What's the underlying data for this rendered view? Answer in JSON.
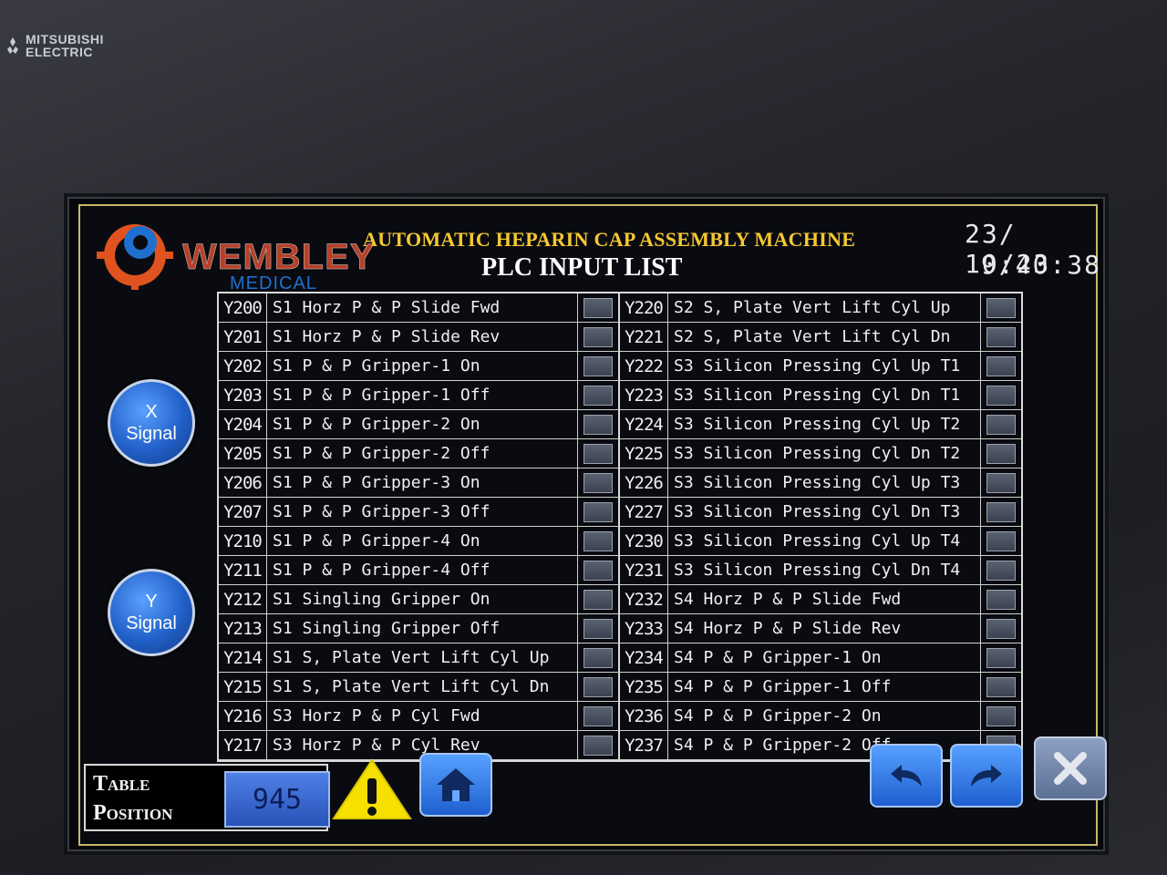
{
  "bezel": {
    "brand_line1": "MITSUBISHI",
    "brand_line2": "ELECTRIC"
  },
  "header": {
    "company": "WEMBLEY",
    "company_sub": "MEDICAL",
    "machine_title": "AUTOMATIC HEPARIN CAP ASSEMBLY MACHINE",
    "screen_title": "PLC INPUT LIST",
    "date": "23/ 10/23",
    "time": "9:40:38"
  },
  "side_buttons": {
    "x_signal": {
      "line1": "X",
      "line2": "Signal"
    },
    "y_signal": {
      "line1": "Y",
      "line2": "Signal"
    }
  },
  "left_rows": [
    {
      "addr": "Y200",
      "desc": "S1 Horz P & P Slide Fwd"
    },
    {
      "addr": "Y201",
      "desc": "S1 Horz P & P Slide Rev"
    },
    {
      "addr": "Y202",
      "desc": "S1 P & P Gripper-1 On"
    },
    {
      "addr": "Y203",
      "desc": "S1 P & P Gripper-1 Off"
    },
    {
      "addr": "Y204",
      "desc": "S1 P & P Gripper-2 On"
    },
    {
      "addr": "Y205",
      "desc": "S1 P & P Gripper-2 Off"
    },
    {
      "addr": "Y206",
      "desc": "S1 P & P Gripper-3 On"
    },
    {
      "addr": "Y207",
      "desc": "S1 P & P Gripper-3 Off"
    },
    {
      "addr": "Y210",
      "desc": "S1 P & P Gripper-4 On"
    },
    {
      "addr": "Y211",
      "desc": "S1 P & P Gripper-4 Off"
    },
    {
      "addr": "Y212",
      "desc": "S1 Singling Gripper On"
    },
    {
      "addr": "Y213",
      "desc": "S1 Singling Gripper Off"
    },
    {
      "addr": "Y214",
      "desc": "S1 S, Plate Vert Lift Cyl Up"
    },
    {
      "addr": "Y215",
      "desc": "S1 S, Plate Vert Lift Cyl Dn"
    },
    {
      "addr": "Y216",
      "desc": "S3 Horz P & P Cyl Fwd"
    },
    {
      "addr": "Y217",
      "desc": "S3 Horz P & P Cyl Rev"
    }
  ],
  "right_rows": [
    {
      "addr": "Y220",
      "desc": "S2 S, Plate Vert Lift Cyl Up"
    },
    {
      "addr": "Y221",
      "desc": "S2 S, Plate Vert Lift Cyl Dn"
    },
    {
      "addr": "Y222",
      "desc": "S3 Silicon Pressing Cyl Up T1"
    },
    {
      "addr": "Y223",
      "desc": "S3 Silicon Pressing Cyl Dn T1"
    },
    {
      "addr": "Y224",
      "desc": "S3 Silicon Pressing Cyl Up T2"
    },
    {
      "addr": "Y225",
      "desc": "S3 Silicon Pressing Cyl Dn T2"
    },
    {
      "addr": "Y226",
      "desc": "S3 Silicon Pressing Cyl Up T3"
    },
    {
      "addr": "Y227",
      "desc": "S3 Silicon Pressing Cyl Dn T3"
    },
    {
      "addr": "Y230",
      "desc": "S3 Silicon Pressing Cyl Up T4"
    },
    {
      "addr": "Y231",
      "desc": "S3 Silicon Pressing Cyl Dn T4"
    },
    {
      "addr": "Y232",
      "desc": "S4 Horz P & P Slide Fwd"
    },
    {
      "addr": "Y233",
      "desc": "S4 Horz P & P Slide Rev"
    },
    {
      "addr": "Y234",
      "desc": "S4 P & P Gripper-1 On"
    },
    {
      "addr": "Y235",
      "desc": "S4 P & P Gripper-1 Off"
    },
    {
      "addr": "Y236",
      "desc": "S4 P & P Gripper-2 On"
    },
    {
      "addr": "Y237",
      "desc": "S4 P & P Gripper-2 Off"
    }
  ],
  "bottom": {
    "table_position_line1": "Table",
    "table_position_line2": "Position",
    "table_position_value": "945"
  },
  "icons": {
    "warning": "warning-icon",
    "home": "home-icon",
    "back": "undo-arrow-icon",
    "forward": "redo-arrow-icon",
    "close": "close-icon"
  },
  "colors": {
    "title_yellow": "#f5c832",
    "button_blue": "#2160c8",
    "lamp_off": "#4a5161",
    "company_orange": "#d64a2c"
  }
}
